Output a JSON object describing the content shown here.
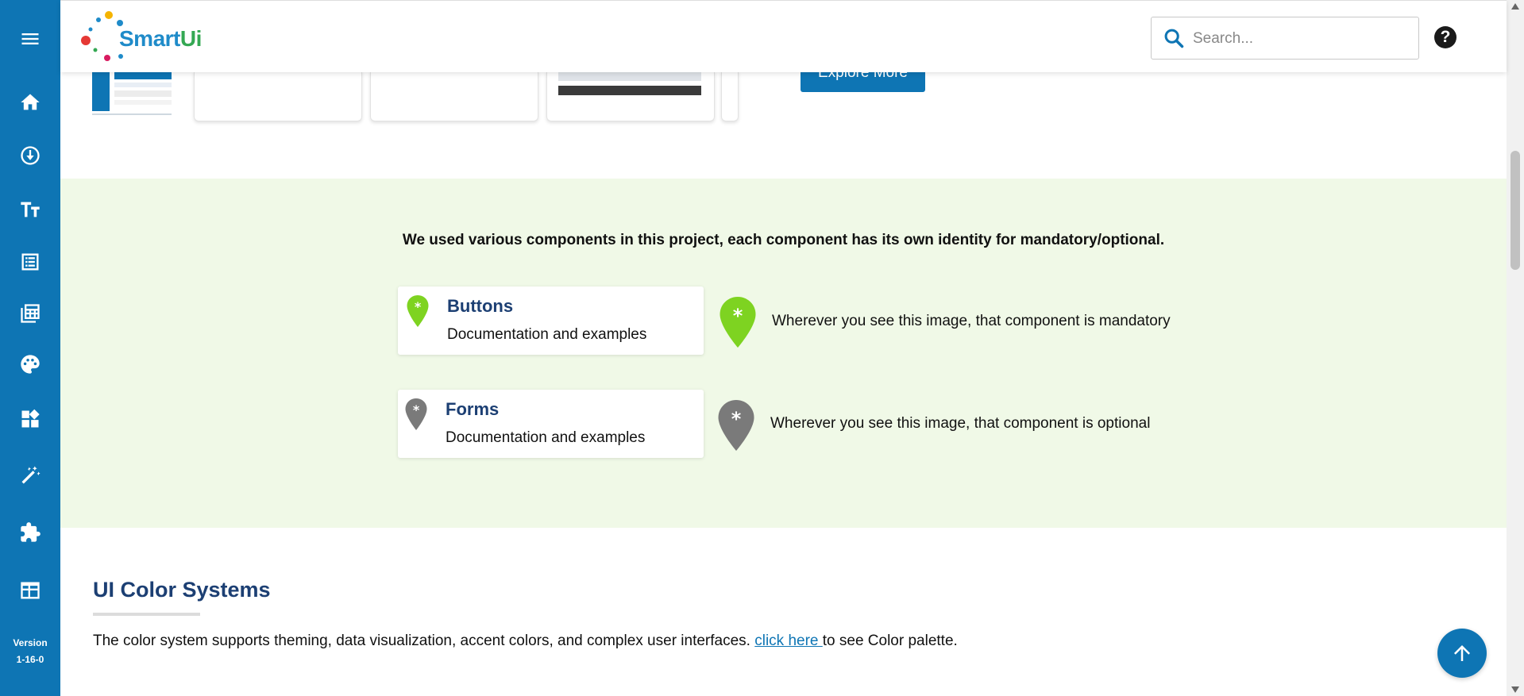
{
  "app": {
    "logo_text_a": "Smart",
    "logo_text_b": "Ui",
    "version_label": "Version",
    "version_number": "1-16-0"
  },
  "sidebar": {
    "items": [
      {
        "name": "menu-icon"
      },
      {
        "name": "home-icon"
      },
      {
        "name": "download-icon"
      },
      {
        "name": "typography-icon"
      },
      {
        "name": "list-icon"
      },
      {
        "name": "calculator-icon"
      },
      {
        "name": "palette-icon"
      },
      {
        "name": "widgets-icon"
      },
      {
        "name": "magic-wand-icon"
      },
      {
        "name": "puzzle-icon"
      },
      {
        "name": "table-icon"
      }
    ]
  },
  "header": {
    "search_placeholder": "Search...",
    "help_label": "?"
  },
  "strip": {
    "explore_label": "Explore More"
  },
  "band": {
    "title": "We used various components in this project, each component has its own identity for mandatory/optional.",
    "cards": [
      {
        "title": "Buttons",
        "subtitle": "Documentation and examples",
        "color": "#7ed321"
      },
      {
        "title": "Forms",
        "subtitle": "Documentation and examples",
        "color": "#7a7a7a"
      }
    ],
    "legend": [
      {
        "text": "Wherever you see this image, that component is mandatory",
        "color": "#7ed321"
      },
      {
        "text": "Wherever you see this image, that component is optional",
        "color": "#7a7a7a"
      }
    ]
  },
  "color_section": {
    "title": "UI Color Systems",
    "text_before": "The color system supports theming, data visualization, accent colors, and complex user interfaces. ",
    "link_text": "click here ",
    "text_after": "to see Color palette."
  },
  "colors": {
    "primary": "#0e75b4",
    "heading": "#1c3f73",
    "band_bg": "#f0f9e7",
    "mandatory": "#7ed321",
    "optional": "#7a7a7a"
  }
}
